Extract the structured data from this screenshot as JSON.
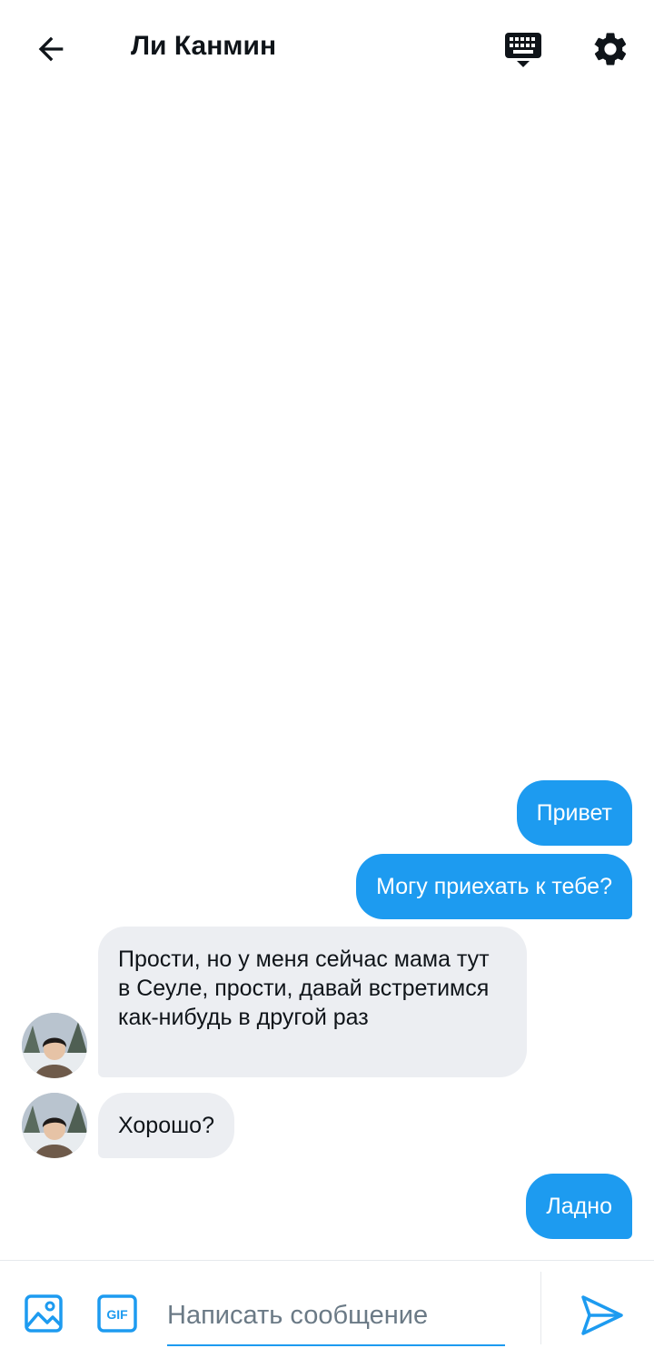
{
  "header": {
    "title": "Ли Канмин"
  },
  "messages": [
    {
      "direction": "outgoing",
      "text": "Привет"
    },
    {
      "direction": "outgoing",
      "text": "Могу приехать к тебе?"
    },
    {
      "direction": "incoming",
      "text": "Прости, но у меня сейчас мама тут в Сеуле, прости, давай встретимся как-нибудь в другой раз"
    },
    {
      "direction": "incoming",
      "text": "Хорошо?"
    },
    {
      "direction": "outgoing",
      "text": "Ладно"
    }
  ],
  "composer": {
    "placeholder": "Написать сообщение",
    "value": "",
    "gif_label": "GIF"
  },
  "icons": {
    "back": "arrow-left-icon",
    "keyboard": "keyboard-icon",
    "settings": "gear-icon",
    "media": "image-icon",
    "gif": "gif-icon",
    "send": "send-icon"
  },
  "colors": {
    "accent": "#1d9bf0",
    "incoming_bubble": "#eceef2",
    "text": "#0f1419",
    "placeholder": "#6b7a86"
  }
}
